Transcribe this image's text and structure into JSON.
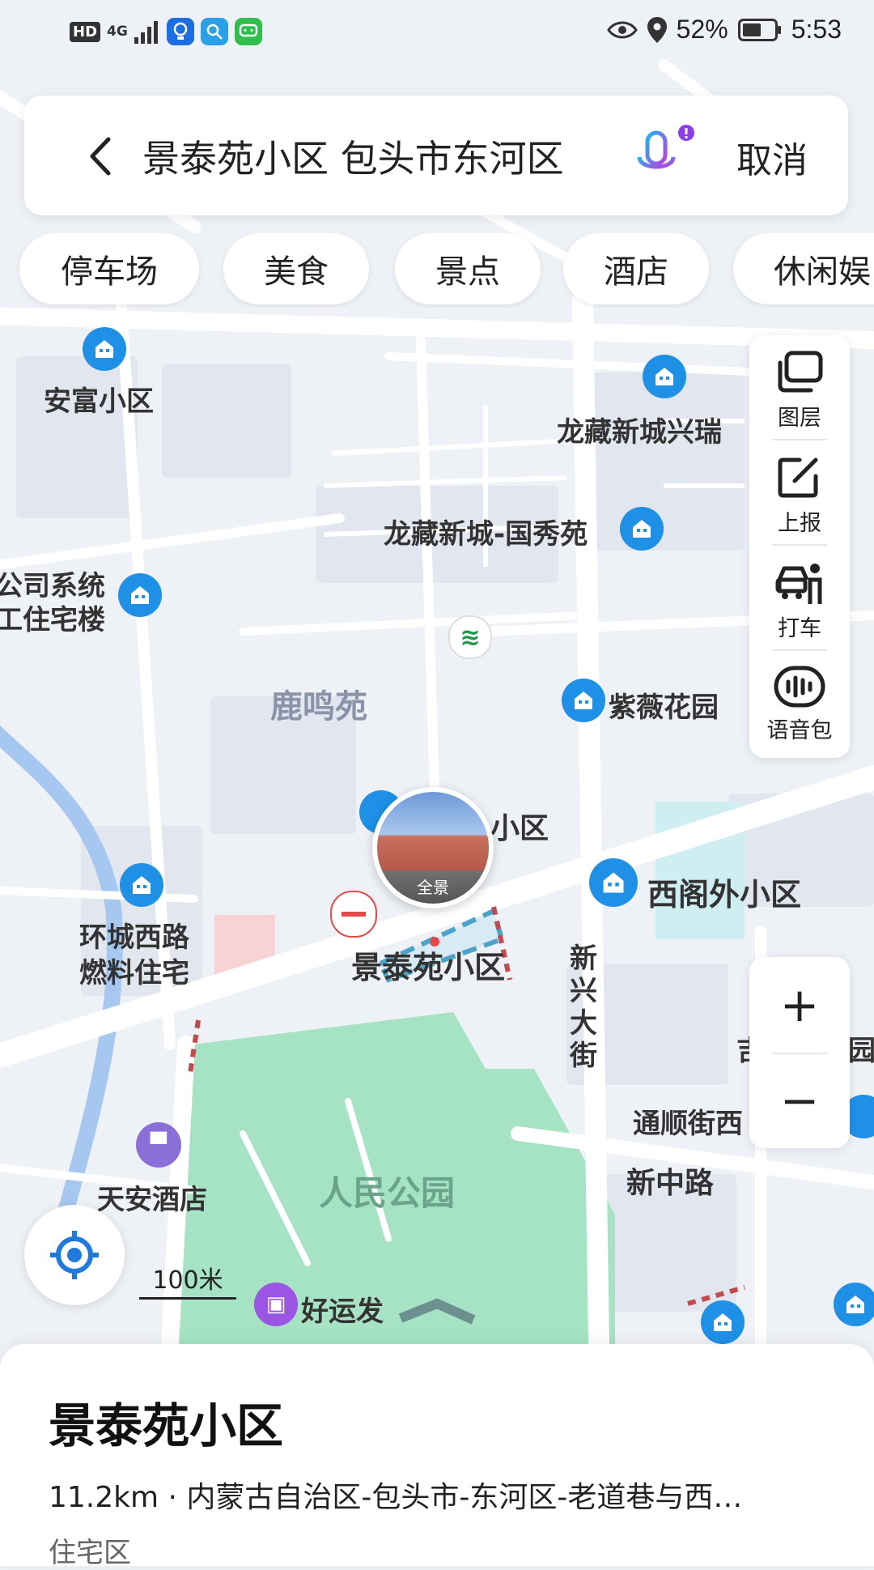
{
  "status": {
    "left_badges": [
      "HD",
      "4G"
    ],
    "battery": "52%",
    "time": "5:53"
  },
  "search": {
    "query": "景泰苑小区 包头市东河区",
    "cancel": "取消"
  },
  "chips": [
    "停车场",
    "美食",
    "景点",
    "酒店",
    "休闲娱"
  ],
  "tools": [
    "图层",
    "上报",
    "打车",
    "语音包"
  ],
  "zoom": {
    "in": "+",
    "out": "−"
  },
  "scale": "100米",
  "map_labels": {
    "anfu": "安富小区",
    "longzang_xr": "龙藏新城兴瑞",
    "longzang_gxy": "龙藏新城-国秀苑",
    "company1": "公司系统",
    "company2": "工住宅楼",
    "lumingyuan": "鹿鸣苑",
    "ziwei": "紫薇花园",
    "xiaoqu_partial": "小区",
    "xige": "西阁外小区",
    "huancheng1": "环城西路",
    "huancheng2": "燃料住宅",
    "jingtai": "景泰苑小区",
    "xinxing": "新兴大街",
    "tongshun": "通顺街西",
    "xinzhong": "新中路",
    "renmin": "人民公园",
    "tianan": "天安酒店",
    "haoyunfa": "好运发",
    "pano": "全景",
    "edge_partial1": "吉",
    "edge_partial2": "园"
  },
  "sheet": {
    "title": "景泰苑小区",
    "address": "11.2km · 内蒙古自治区-包头市-东河区-老道巷与西…",
    "type": "住宅区"
  },
  "colors": {
    "poi_blue": "#1e90e6",
    "park_green": "#a5e3c4",
    "accent": "#1f7ae0"
  }
}
